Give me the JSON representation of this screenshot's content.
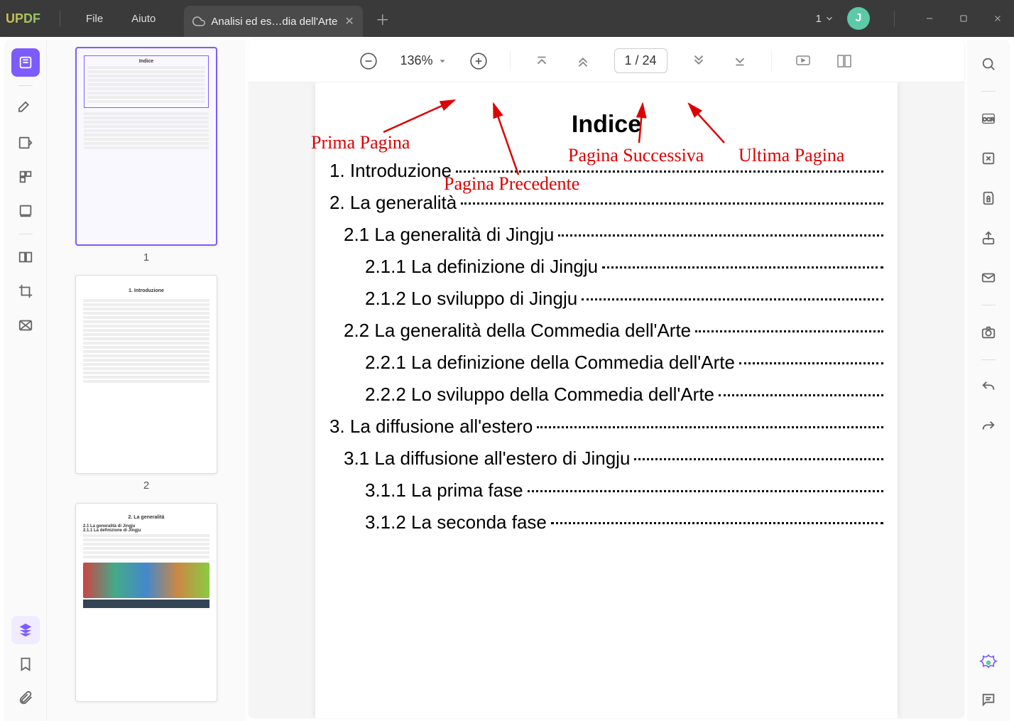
{
  "app": {
    "name": "UPDF"
  },
  "menu": {
    "file": "File",
    "help": "Aiuto"
  },
  "tab": {
    "title": "Analisi ed es…dia dell'Arte"
  },
  "workspace": {
    "number": "1"
  },
  "avatar": {
    "initial": "J"
  },
  "toolbar": {
    "zoom_value": "136%",
    "page_indicator": "1  /  24"
  },
  "thumbnails": {
    "page1": "1",
    "page2": "2"
  },
  "doc": {
    "title": "Indice",
    "toc": [
      {
        "level": "l1",
        "text": "1. Introduzione"
      },
      {
        "level": "l1",
        "text": "2. La generalità"
      },
      {
        "level": "l2",
        "text": "2.1 La generalità di Jingju"
      },
      {
        "level": "l3",
        "text": "2.1.1 La definizione di Jingju"
      },
      {
        "level": "l3",
        "text": "2.1.2 Lo sviluppo di Jingju"
      },
      {
        "level": "l2",
        "text": "2.2 La generalità della Commedia dell'Arte"
      },
      {
        "level": "l3",
        "text": "2.2.1 La definizione della Commedia dell'Arte"
      },
      {
        "level": "l3",
        "text": "2.2.2 Lo sviluppo della Commedia dell'Arte"
      },
      {
        "level": "l1",
        "text": "3. La diffusione all'estero"
      },
      {
        "level": "l2",
        "text": "3.1 La diffusione all'estero di Jingju"
      },
      {
        "level": "l3",
        "text": "3.1.1 La prima fase"
      },
      {
        "level": "l3",
        "text": "3.1.2 La seconda fase"
      }
    ]
  },
  "annotations": {
    "first_page": "Prima Pagina",
    "prev_page": "Pagina Precedente",
    "next_page": "Pagina Successiva",
    "last_page": "Ultima Pagina"
  }
}
